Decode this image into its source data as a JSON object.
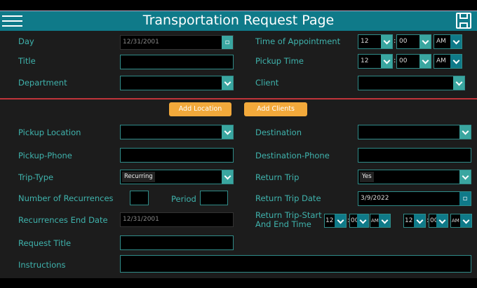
{
  "header": {
    "title": "Transportation Request Page",
    "menu_icon": "hamburger-icon",
    "save_icon": "floppy-disk-icon"
  },
  "top": {
    "day_label": "Day",
    "day_value": "12/31/2001",
    "title_label": "Title",
    "department_label": "Department",
    "appt_label": "Time of Appointment",
    "appt_hour": "12",
    "appt_min": "00",
    "appt_ampm": "AM",
    "pickup_time_label": "Pickup Time",
    "pickup_hour": "12",
    "pickup_min": "00",
    "pickup_ampm": "AM",
    "client_label": "Client",
    "colon": ":"
  },
  "buttons": {
    "add_location": "Add Location",
    "add_clients": "Add Clients"
  },
  "form": {
    "pickup_location_label": "Pickup Location",
    "destination_label": "Destination",
    "pickup_phone_label": "Pickup-Phone",
    "destination_phone_label": "Destination-Phone",
    "trip_type_label": "Trip-Type",
    "trip_type_value": "Recurring",
    "return_trip_label": "Return Trip",
    "return_trip_value": "Yes",
    "recurrences_label": "Number of Recurrences",
    "period_label": "Period",
    "return_date_label": "Return Trip Date",
    "return_date_value": "3/9/2022",
    "rec_end_label": "Recurrences End Date",
    "rec_end_value": "12/31/2001",
    "return_time_label_1": "Return Trip-Start",
    "return_time_label_2": "And End Time",
    "start_hour": "12",
    "start_min": "00",
    "start_ampm": "AM",
    "end_hour": "12",
    "end_min": "00",
    "end_ampm": "AM",
    "request_title_label": "Request Title",
    "instructions_label": "Instructions"
  },
  "colors": {
    "header": "#0f7a89",
    "label": "#3fb3ad",
    "button": "#f2a93b",
    "divider": "#c0343a"
  }
}
